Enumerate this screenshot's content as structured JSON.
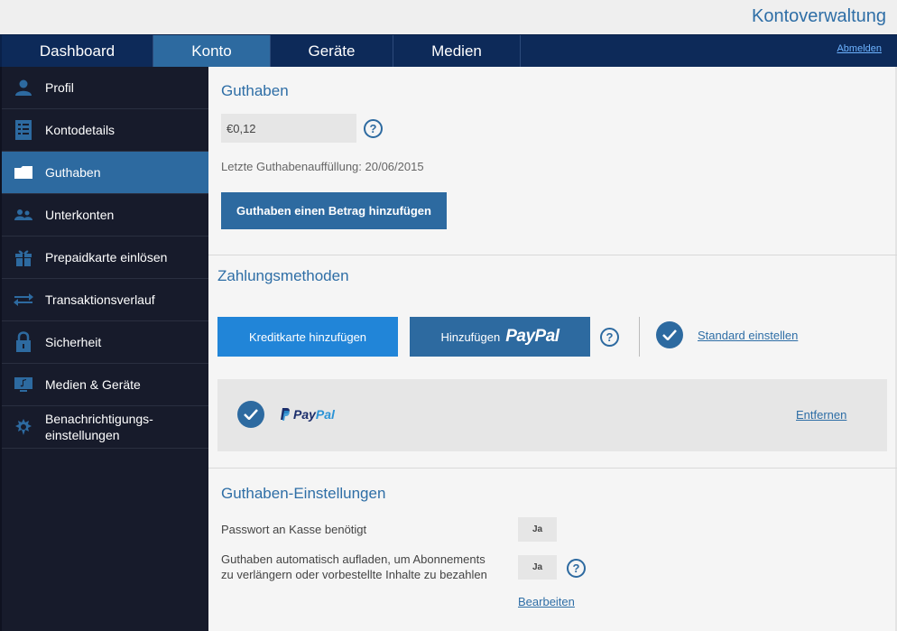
{
  "header": {
    "title": "Kontoverwaltung"
  },
  "nav": {
    "tabs": [
      {
        "label": "Dashboard"
      },
      {
        "label": "Konto"
      },
      {
        "label": "Geräte"
      },
      {
        "label": "Medien"
      }
    ],
    "logout": "Abmelden"
  },
  "sidebar": {
    "items": [
      {
        "label": "Profil",
        "icon": "user-icon"
      },
      {
        "label": "Kontodetails",
        "icon": "document-icon"
      },
      {
        "label": "Guthaben",
        "icon": "wallet-icon"
      },
      {
        "label": "Unterkonten",
        "icon": "users-icon"
      },
      {
        "label": "Prepaidkarte einlösen",
        "icon": "gift-icon"
      },
      {
        "label": "Transaktionsverlauf",
        "icon": "transfer-icon"
      },
      {
        "label": "Sicherheit",
        "icon": "lock-icon"
      },
      {
        "label": "Medien & Geräte",
        "icon": "media-device-icon"
      },
      {
        "label": "Benachrichtigungs-",
        "label2": "einstellungen",
        "icon": "notification-gear-icon"
      }
    ]
  },
  "balance": {
    "title": "Guthaben",
    "value": "€0,12",
    "last_topup": "Letzte Guthabenauffüllung: 20/06/2015",
    "add_button": "Guthaben einen Betrag hinzufügen",
    "help": "?"
  },
  "payment": {
    "title": "Zahlungsmethoden",
    "add_card_button": "Kreditkarte hinzufügen",
    "add_paypal_prefix": "Hinzufügen",
    "paypal_logo_text": "PayPal",
    "help": "?",
    "set_default": "Standard einstellen",
    "method": {
      "logo_part1": "Pay",
      "logo_part2": "Pal",
      "remove": "Entfernen"
    }
  },
  "settings": {
    "title": "Guthaben-Einstellungen",
    "rows": [
      {
        "label": "Passwort an Kasse benötigt",
        "value": "Ja"
      },
      {
        "label": "Guthaben automatisch aufladen, um Abonnements",
        "label2": "zu verlängern oder vorbestellte Inhalte zu bezahlen",
        "value": "Ja"
      }
    ],
    "help": "?",
    "edit": "Bearbeiten"
  },
  "colors": {
    "accent": "#2d6aa0",
    "nav_bg": "#0d2a59",
    "sidebar_bg": "#171b2b",
    "link": "#2e6ea6"
  }
}
